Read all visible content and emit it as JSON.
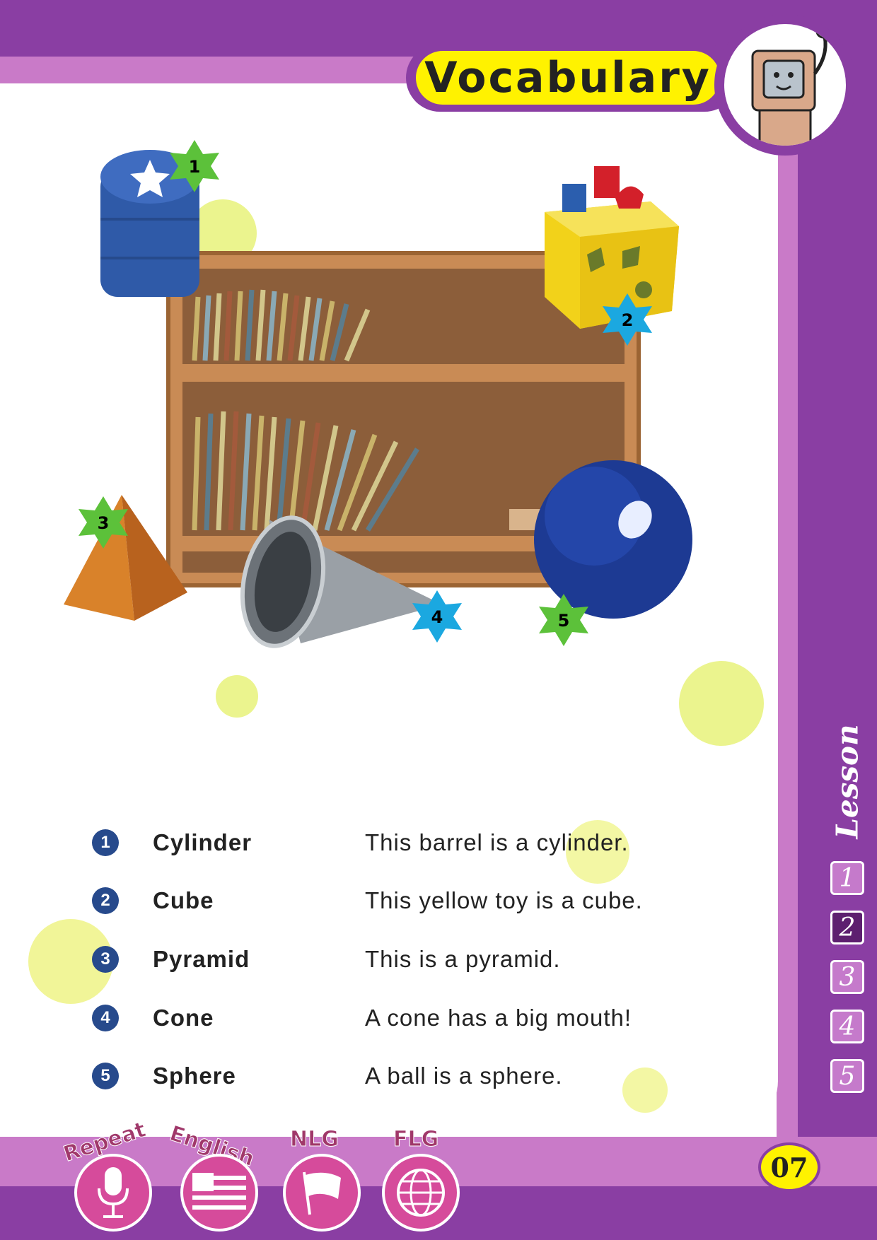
{
  "header": {
    "title": "Vocabulary"
  },
  "lesson": {
    "label": "Lesson",
    "numbers": [
      "1",
      "2",
      "3",
      "4",
      "5"
    ],
    "active": "2"
  },
  "illustration": {
    "stars": [
      {
        "number": "1",
        "color": "#5cc13a"
      },
      {
        "number": "2",
        "color": "#1ba8e0"
      },
      {
        "number": "3",
        "color": "#5cc13a"
      },
      {
        "number": "4",
        "color": "#1ba8e0"
      },
      {
        "number": "5",
        "color": "#5cc13a"
      }
    ]
  },
  "vocabulary": [
    {
      "number": "1",
      "word": "Cylinder",
      "sentence": "This barrel is a cylinder."
    },
    {
      "number": "2",
      "word": "Cube",
      "sentence": "This yellow toy is a cube."
    },
    {
      "number": "3",
      "word": "Pyramid",
      "sentence": "This is a pyramid."
    },
    {
      "number": "4",
      "word": "Cone",
      "sentence": "A cone has a big mouth!"
    },
    {
      "number": "5",
      "word": "Sphere",
      "sentence": "A ball is a sphere."
    }
  ],
  "footer": {
    "icons": [
      {
        "label": "Repeat",
        "icon": "microphone-icon"
      },
      {
        "label": "English",
        "icon": "us-flag-icon"
      },
      {
        "label": "NLG",
        "icon": "flag-icon"
      },
      {
        "label": "FLG",
        "icon": "globe-icon"
      }
    ],
    "page_number": "07"
  },
  "colors": {
    "frame_dark": "#8a3ea3",
    "frame_light": "#c97ac8",
    "title_yellow": "#fff200",
    "badge_blue": "#274a8c"
  }
}
